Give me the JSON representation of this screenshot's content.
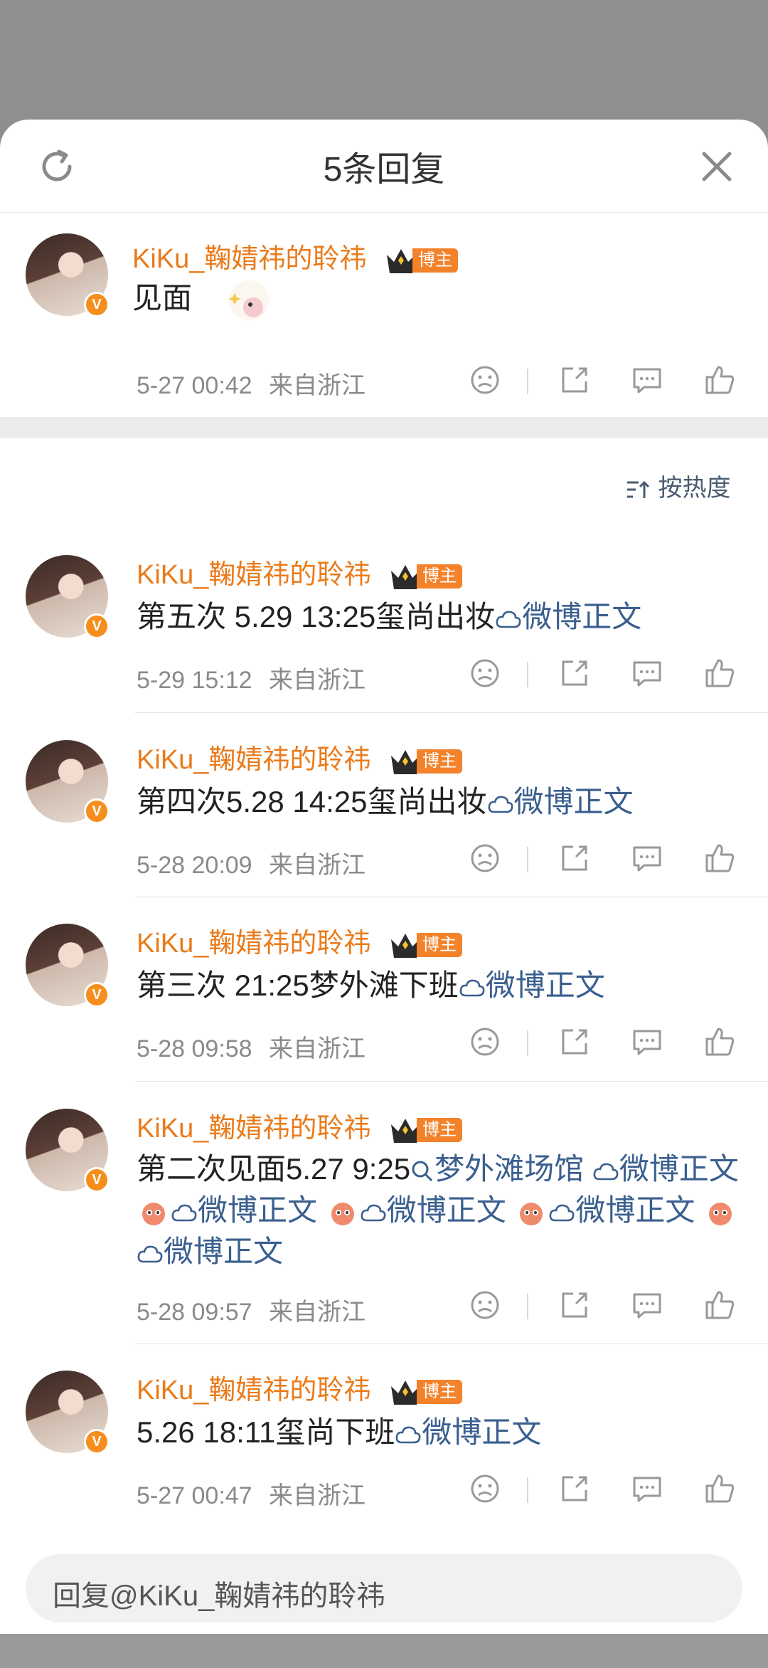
{
  "header": {
    "title": "5条回复"
  },
  "main_comment": {
    "username": "KiKu_鞠婧祎的聆祎",
    "badge": "博主",
    "text": "见面",
    "time": "5-27 00:42",
    "location": "来自浙江"
  },
  "sort_label": "按热度",
  "replies": [
    {
      "username": "KiKu_鞠婧祎的聆祎",
      "badge": "博主",
      "text": "第五次 5.29 13:25玺尚出妆",
      "link": "微博正文",
      "time": "5-29 15:12",
      "location": "来自浙江"
    },
    {
      "username": "KiKu_鞠婧祎的聆祎",
      "badge": "博主",
      "text": "第四次5.28 14:25玺尚出妆",
      "link": "微博正文",
      "time": "5-28 20:09",
      "location": "来自浙江"
    },
    {
      "username": "KiKu_鞠婧祎的聆祎",
      "badge": "博主",
      "text": "第三次 21:25梦外滩下班",
      "link": "微博正文",
      "time": "5-28 09:58",
      "location": "来自浙江"
    },
    {
      "username": "KiKu_鞠婧祎的聆祎",
      "badge": "博主",
      "text": "第二次见面5.27 9:25",
      "search_link": "梦外滩场馆",
      "link": "微博正文",
      "time": "5-28 09:57",
      "location": "来自浙江"
    },
    {
      "username": "KiKu_鞠婧祎的聆祎",
      "badge": "博主",
      "text": "5.26 18:11玺尚下班",
      "link": "微博正文",
      "time": "5-27 00:47",
      "location": "来自浙江"
    }
  ],
  "reply_input": {
    "placeholder": "回复@KiKu_鞠婧祎的聆祎"
  },
  "colors": {
    "username": "#ea7a1a",
    "link": "#3a5f8f",
    "badge": "#f3822b",
    "meta": "#8a8a8a"
  }
}
